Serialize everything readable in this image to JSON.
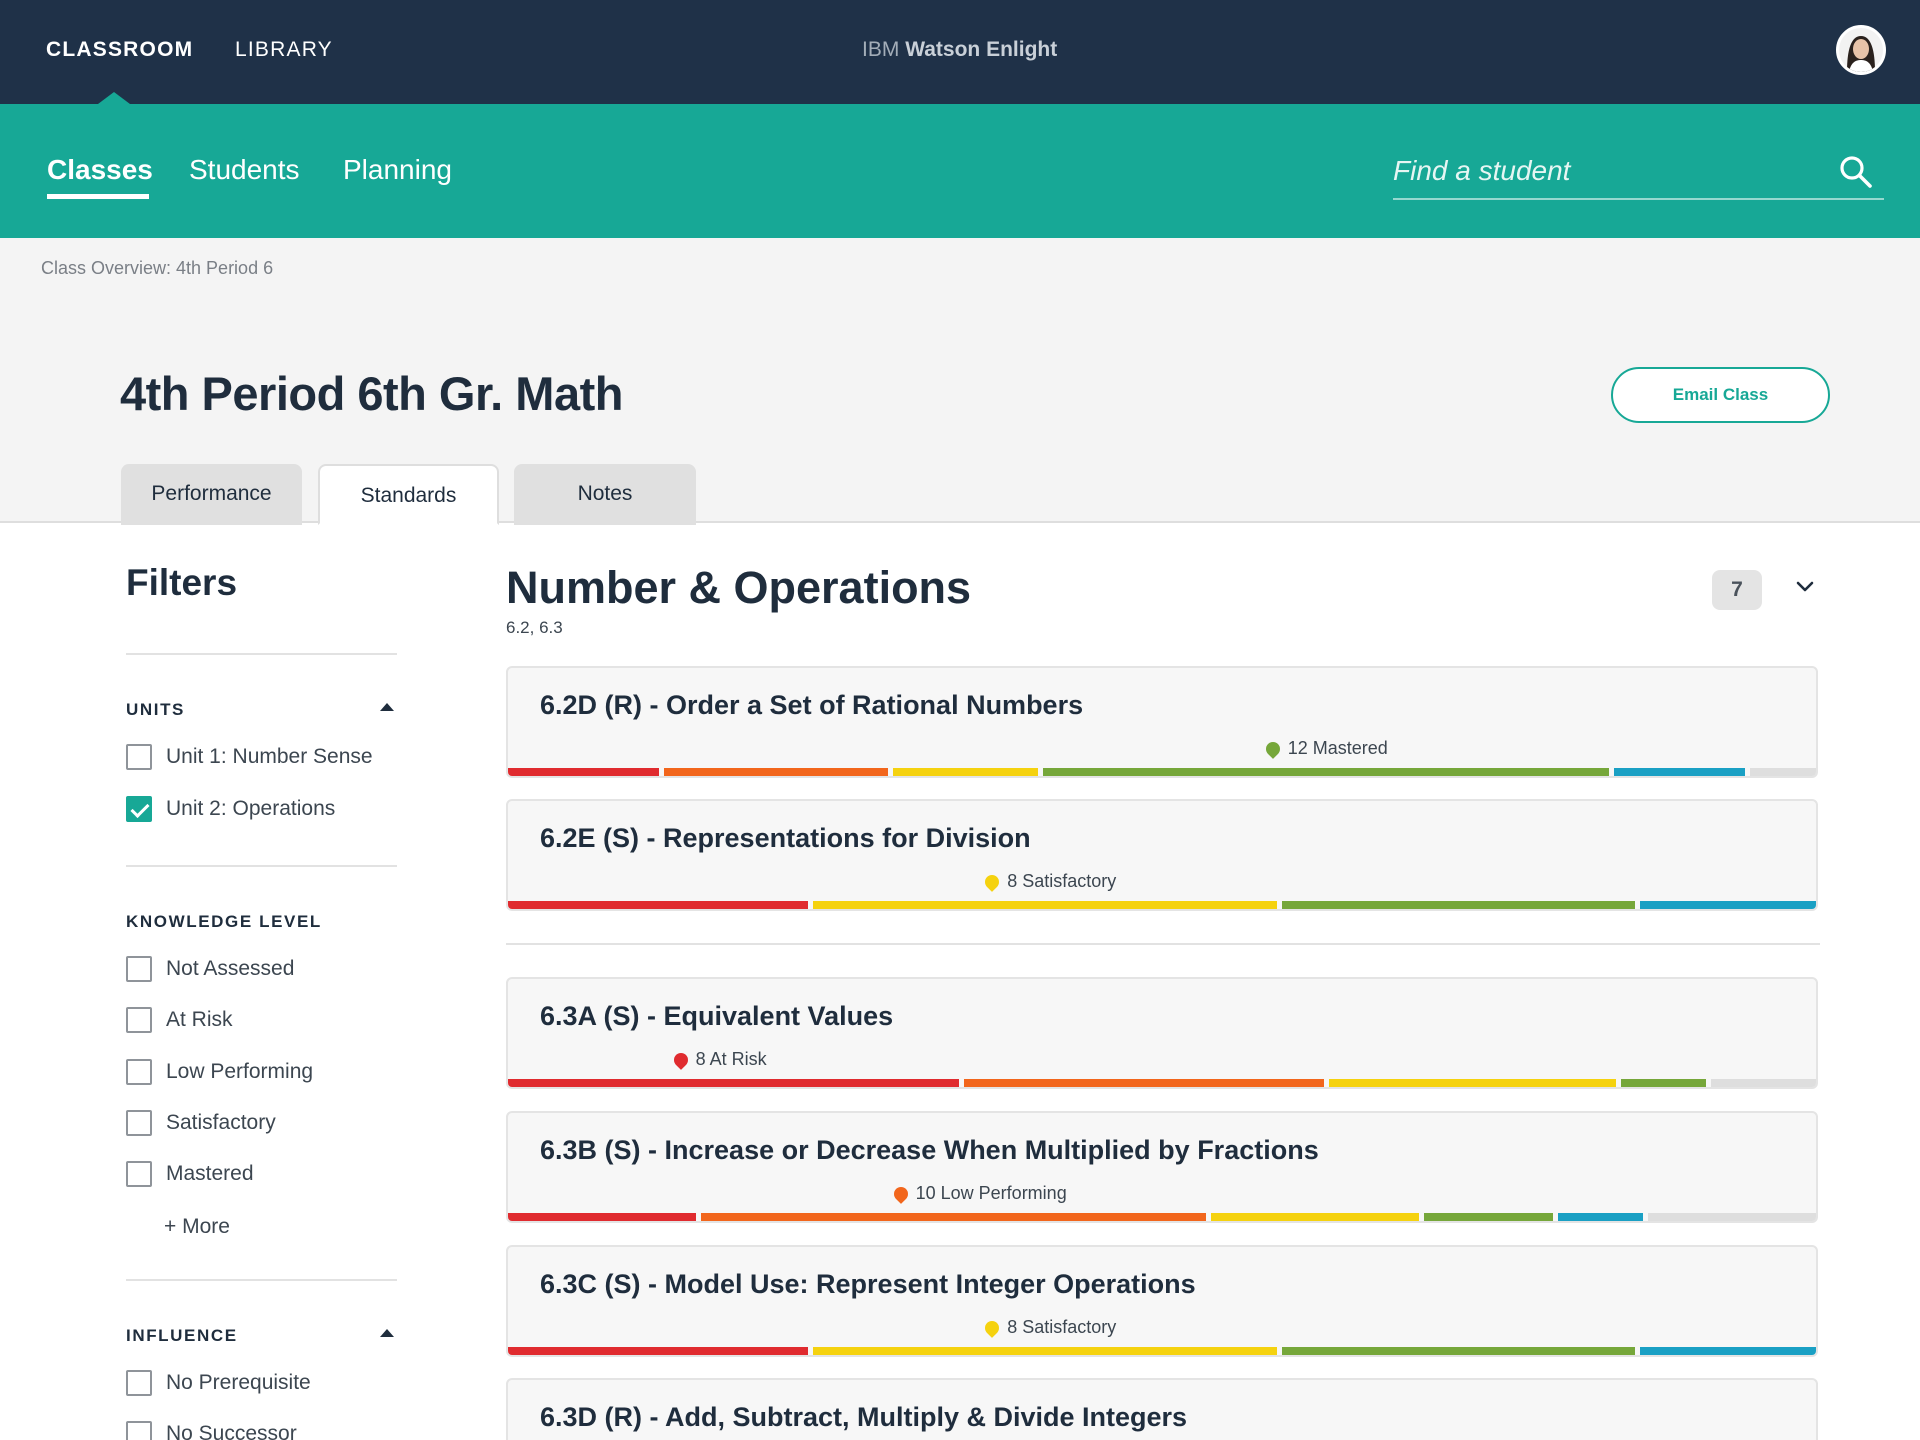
{
  "topbar": {
    "nav": [
      {
        "label": "CLASSROOM",
        "active": true
      },
      {
        "label": "LIBRARY",
        "active": false
      }
    ],
    "brand_prefix": "IBM",
    "brand_name": "Watson Enlight"
  },
  "subnav": {
    "items": [
      {
        "label": "Classes",
        "active": true
      },
      {
        "label": "Students",
        "active": false
      },
      {
        "label": "Planning",
        "active": false
      }
    ],
    "search_placeholder": "Find a student"
  },
  "header": {
    "breadcrumb": "Class Overview: 4th Period 6",
    "title": "4th Period 6th Gr. Math",
    "email_button": "Email Class",
    "tabs": [
      {
        "label": "Performance",
        "active": false
      },
      {
        "label": "Standards",
        "active": true
      },
      {
        "label": "Notes",
        "active": false
      }
    ]
  },
  "filters": {
    "title": "Filters",
    "units": {
      "title": "UNITS",
      "options": [
        {
          "label": "Unit 1: Number Sense",
          "checked": false
        },
        {
          "label": "Unit 2: Operations",
          "checked": true
        }
      ]
    },
    "knowledge": {
      "title": "KNOWLEDGE LEVEL",
      "options": [
        {
          "label": "Not Assessed",
          "checked": false
        },
        {
          "label": "At Risk",
          "checked": false
        },
        {
          "label": "Low Performing",
          "checked": false
        },
        {
          "label": "Satisfactory",
          "checked": false
        },
        {
          "label": "Mastered",
          "checked": false
        }
      ],
      "more": "+ More"
    },
    "influence": {
      "title": "INFLUENCE",
      "options": [
        {
          "label": "No Prerequisite",
          "checked": false
        },
        {
          "label": "No Successor",
          "checked": false
        }
      ]
    }
  },
  "main": {
    "section_title": "Number & Operations",
    "section_sub": "6.2, 6.3",
    "count": "7",
    "level_colors": {
      "at_risk": "#e02b2f",
      "low_performing": "#f2661c",
      "satisfactory": "#f5d20f",
      "mastered": "#76a73a",
      "advanced": "#1aa0c4",
      "not_assessed": "#dedede"
    },
    "cards": [
      {
        "title": "6.2D (R) - Order a Set of Rational Numbers",
        "marker": "12 Mastered",
        "marker_level": "mastered",
        "distribution": [
          11.5,
          17,
          11,
          43,
          10,
          5
        ]
      },
      {
        "title": "6.2E (S) - Representations for Division",
        "marker": "8 Satisfactory",
        "marker_level": "satisfactory",
        "distribution": [
          23,
          0,
          35.5,
          27,
          13.5,
          0
        ]
      },
      {
        "title": "6.3A (S) - Equivalent Values",
        "marker": "8 At Risk",
        "marker_level": "at_risk",
        "distribution": [
          34.5,
          27.5,
          22,
          6.5,
          0,
          8
        ]
      },
      {
        "title": "6.3B (S) - Increase or Decrease When Multiplied by Fractions",
        "marker": "10 Low Performing",
        "marker_level": "low_performing",
        "distribution": [
          14.5,
          39,
          16,
          10,
          6.5,
          13
        ]
      },
      {
        "title": "6.3C (S) - Model Use: Represent Integer Operations",
        "marker": "8 Satisfactory",
        "marker_level": "satisfactory",
        "distribution": [
          23,
          0,
          35.5,
          27,
          13.5,
          0
        ]
      },
      {
        "title": "6.3D (R) - Add, Subtract, Multiply & Divide Integers",
        "marker": "",
        "marker_level": "",
        "distribution": []
      }
    ]
  }
}
